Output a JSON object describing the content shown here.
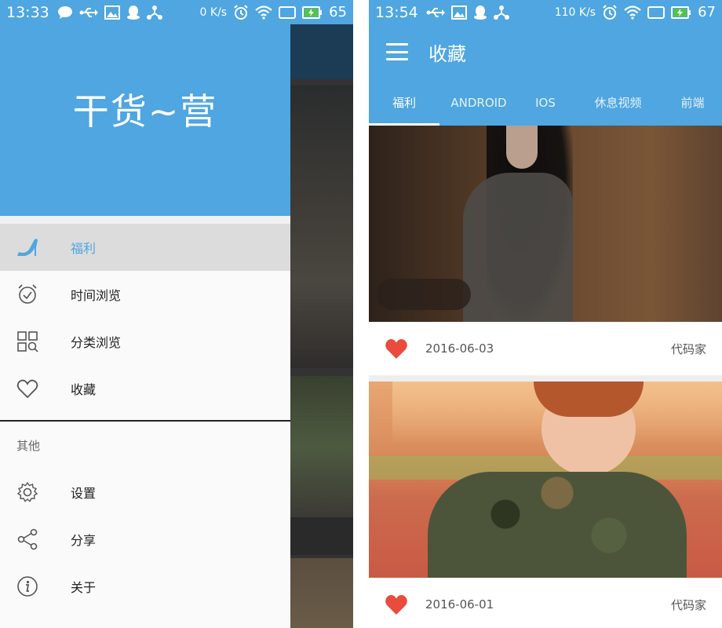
{
  "left": {
    "status": {
      "time": "13:33",
      "speed": "0 K/s",
      "battery": "65"
    },
    "drawer": {
      "title": "干货~营",
      "items": [
        {
          "label": "福利",
          "icon": "high-heel-icon",
          "active": true
        },
        {
          "label": "时间浏览",
          "icon": "alarm-clock-icon"
        },
        {
          "label": "分类浏览",
          "icon": "grid-search-icon"
        },
        {
          "label": "收藏",
          "icon": "heart-outline-icon"
        }
      ],
      "section_label": "其他",
      "other_items": [
        {
          "label": "设置",
          "icon": "gear-icon"
        },
        {
          "label": "分享",
          "icon": "share-icon"
        },
        {
          "label": "关于",
          "icon": "info-icon"
        }
      ]
    }
  },
  "right": {
    "status": {
      "time": "13:54",
      "speed": "110 K/s",
      "battery": "67"
    },
    "appbar": {
      "title": "收藏"
    },
    "tabs": [
      "福利",
      "ANDROID",
      "IOS",
      "休息视频",
      "前端"
    ],
    "cards": [
      {
        "date": "2016-06-03",
        "author": "代码家"
      },
      {
        "date": "2016-06-01",
        "author": "代码家"
      }
    ]
  },
  "colors": {
    "primary": "#4fa6e0",
    "heart": "#e94b3c",
    "active_bg": "#dcdcdc"
  }
}
